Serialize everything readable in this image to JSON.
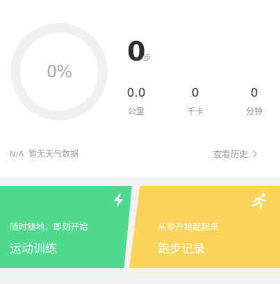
{
  "progress": {
    "percent_label": "0%",
    "fraction": 0
  },
  "steps": {
    "value": "0",
    "unit": "步"
  },
  "stats": [
    {
      "value": "0.0",
      "label": "公里"
    },
    {
      "value": "0",
      "label": "千卡"
    },
    {
      "value": "0",
      "label": "分钟"
    }
  ],
  "weather": {
    "na": "N/A",
    "text": "暂无天气数据"
  },
  "history": {
    "label": "查看历史"
  },
  "cards": {
    "training": {
      "subtitle": "随时随地，即刻开始",
      "title": "运动训练",
      "icon": "lightning-icon",
      "color": "#4fd98f"
    },
    "running": {
      "subtitle": "从零开始跑起来",
      "title": "跑步记录",
      "icon": "running-person-icon",
      "color": "#fcd35a"
    }
  }
}
